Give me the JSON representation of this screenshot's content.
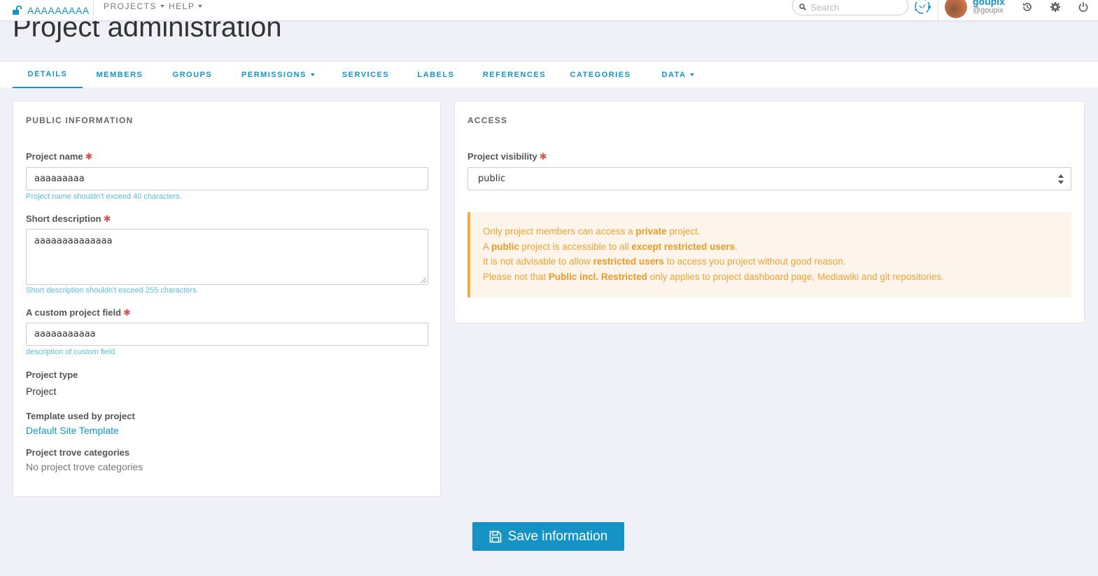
{
  "navbar": {
    "project_name": "AAAAAAAAA",
    "menus": [
      {
        "label": "PROJECTS"
      },
      {
        "label": "HELP"
      }
    ],
    "search_placeholder": "Search",
    "user": {
      "name": "goupix",
      "handle": "@goupix"
    },
    "icons": [
      "history-icon",
      "gear-icon",
      "power-icon"
    ]
  },
  "page": {
    "title": "Project administration"
  },
  "tabs": [
    {
      "label": "DETAILS",
      "active": true,
      "dropdown": false
    },
    {
      "label": "MEMBERS",
      "active": false,
      "dropdown": false
    },
    {
      "label": "GROUPS",
      "active": false,
      "dropdown": false
    },
    {
      "label": "PERMISSIONS",
      "active": false,
      "dropdown": true
    },
    {
      "label": "SERVICES",
      "active": false,
      "dropdown": false
    },
    {
      "label": "LABELS",
      "active": false,
      "dropdown": false
    },
    {
      "label": "REFERENCES",
      "active": false,
      "dropdown": false
    },
    {
      "label": "CATEGORIES",
      "active": false,
      "dropdown": false
    },
    {
      "label": "DATA",
      "active": false,
      "dropdown": true
    }
  ],
  "public_info": {
    "title": "PUBLIC INFORMATION",
    "project_name": {
      "label": "Project name",
      "required": "✱",
      "value": "aaaaaaaaa",
      "help": "Project name shouldn't exceed 40 characters."
    },
    "short_description": {
      "label": "Short description",
      "required": "✱",
      "value": "aaaaaaaaaaaaaa",
      "help": "Short description shouldn't exceed 255 characters."
    },
    "custom_field": {
      "label": "A custom project field",
      "required": "✱",
      "value": "aaaaaaaaaaa",
      "help": "description of custom field"
    },
    "project_type": {
      "label": "Project type",
      "value": "Project"
    },
    "template": {
      "label": "Template used by project",
      "value": "Default Site Template"
    },
    "trove": {
      "label": "Project trove categories",
      "value": "No project trove categories"
    }
  },
  "access": {
    "title": "ACCESS",
    "visibility": {
      "label": "Project visibility",
      "required": "✱",
      "value": "public"
    },
    "alert": {
      "line1": {
        "pre": "Only project members can access a ",
        "b1": "private",
        "post": " project."
      },
      "line2": {
        "pre": "A ",
        "b1": "public",
        "mid": " project is accessible to all ",
        "b2": "except restricted users",
        "post": "."
      },
      "line3": {
        "pre": "It is not advisable to allow ",
        "b1": "restricted users",
        "post": " to access you project without good reason."
      },
      "line4": {
        "pre": "Please not that ",
        "b1": "Public incl. Restricted",
        "post": " only applies to project dashboard page, Mediawiki and git repositories."
      }
    }
  },
  "actions": {
    "save_label": "Save information"
  },
  "colors": {
    "accent": "#1593c5",
    "warning_text": "#f0a230",
    "warning_bg": "#fdf5eb",
    "required": "#d9534f"
  }
}
